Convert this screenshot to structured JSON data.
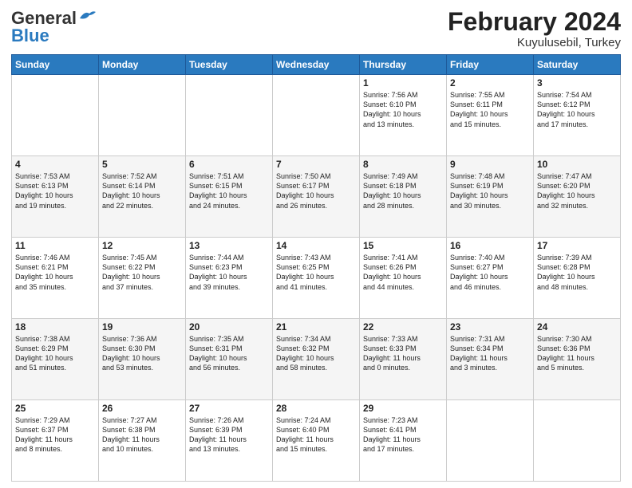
{
  "header": {
    "logo_line1": "General",
    "logo_line2": "Blue",
    "title": "February 2024",
    "subtitle": "Kuyulusebil, Turkey"
  },
  "days_of_week": [
    "Sunday",
    "Monday",
    "Tuesday",
    "Wednesday",
    "Thursday",
    "Friday",
    "Saturday"
  ],
  "weeks": [
    [
      {
        "day": "",
        "info": ""
      },
      {
        "day": "",
        "info": ""
      },
      {
        "day": "",
        "info": ""
      },
      {
        "day": "",
        "info": ""
      },
      {
        "day": "1",
        "info": "Sunrise: 7:56 AM\nSunset: 6:10 PM\nDaylight: 10 hours\nand 13 minutes."
      },
      {
        "day": "2",
        "info": "Sunrise: 7:55 AM\nSunset: 6:11 PM\nDaylight: 10 hours\nand 15 minutes."
      },
      {
        "day": "3",
        "info": "Sunrise: 7:54 AM\nSunset: 6:12 PM\nDaylight: 10 hours\nand 17 minutes."
      }
    ],
    [
      {
        "day": "4",
        "info": "Sunrise: 7:53 AM\nSunset: 6:13 PM\nDaylight: 10 hours\nand 19 minutes."
      },
      {
        "day": "5",
        "info": "Sunrise: 7:52 AM\nSunset: 6:14 PM\nDaylight: 10 hours\nand 22 minutes."
      },
      {
        "day": "6",
        "info": "Sunrise: 7:51 AM\nSunset: 6:15 PM\nDaylight: 10 hours\nand 24 minutes."
      },
      {
        "day": "7",
        "info": "Sunrise: 7:50 AM\nSunset: 6:17 PM\nDaylight: 10 hours\nand 26 minutes."
      },
      {
        "day": "8",
        "info": "Sunrise: 7:49 AM\nSunset: 6:18 PM\nDaylight: 10 hours\nand 28 minutes."
      },
      {
        "day": "9",
        "info": "Sunrise: 7:48 AM\nSunset: 6:19 PM\nDaylight: 10 hours\nand 30 minutes."
      },
      {
        "day": "10",
        "info": "Sunrise: 7:47 AM\nSunset: 6:20 PM\nDaylight: 10 hours\nand 32 minutes."
      }
    ],
    [
      {
        "day": "11",
        "info": "Sunrise: 7:46 AM\nSunset: 6:21 PM\nDaylight: 10 hours\nand 35 minutes."
      },
      {
        "day": "12",
        "info": "Sunrise: 7:45 AM\nSunset: 6:22 PM\nDaylight: 10 hours\nand 37 minutes."
      },
      {
        "day": "13",
        "info": "Sunrise: 7:44 AM\nSunset: 6:23 PM\nDaylight: 10 hours\nand 39 minutes."
      },
      {
        "day": "14",
        "info": "Sunrise: 7:43 AM\nSunset: 6:25 PM\nDaylight: 10 hours\nand 41 minutes."
      },
      {
        "day": "15",
        "info": "Sunrise: 7:41 AM\nSunset: 6:26 PM\nDaylight: 10 hours\nand 44 minutes."
      },
      {
        "day": "16",
        "info": "Sunrise: 7:40 AM\nSunset: 6:27 PM\nDaylight: 10 hours\nand 46 minutes."
      },
      {
        "day": "17",
        "info": "Sunrise: 7:39 AM\nSunset: 6:28 PM\nDaylight: 10 hours\nand 48 minutes."
      }
    ],
    [
      {
        "day": "18",
        "info": "Sunrise: 7:38 AM\nSunset: 6:29 PM\nDaylight: 10 hours\nand 51 minutes."
      },
      {
        "day": "19",
        "info": "Sunrise: 7:36 AM\nSunset: 6:30 PM\nDaylight: 10 hours\nand 53 minutes."
      },
      {
        "day": "20",
        "info": "Sunrise: 7:35 AM\nSunset: 6:31 PM\nDaylight: 10 hours\nand 56 minutes."
      },
      {
        "day": "21",
        "info": "Sunrise: 7:34 AM\nSunset: 6:32 PM\nDaylight: 10 hours\nand 58 minutes."
      },
      {
        "day": "22",
        "info": "Sunrise: 7:33 AM\nSunset: 6:33 PM\nDaylight: 11 hours\nand 0 minutes."
      },
      {
        "day": "23",
        "info": "Sunrise: 7:31 AM\nSunset: 6:34 PM\nDaylight: 11 hours\nand 3 minutes."
      },
      {
        "day": "24",
        "info": "Sunrise: 7:30 AM\nSunset: 6:36 PM\nDaylight: 11 hours\nand 5 minutes."
      }
    ],
    [
      {
        "day": "25",
        "info": "Sunrise: 7:29 AM\nSunset: 6:37 PM\nDaylight: 11 hours\nand 8 minutes."
      },
      {
        "day": "26",
        "info": "Sunrise: 7:27 AM\nSunset: 6:38 PM\nDaylight: 11 hours\nand 10 minutes."
      },
      {
        "day": "27",
        "info": "Sunrise: 7:26 AM\nSunset: 6:39 PM\nDaylight: 11 hours\nand 13 minutes."
      },
      {
        "day": "28",
        "info": "Sunrise: 7:24 AM\nSunset: 6:40 PM\nDaylight: 11 hours\nand 15 minutes."
      },
      {
        "day": "29",
        "info": "Sunrise: 7:23 AM\nSunset: 6:41 PM\nDaylight: 11 hours\nand 17 minutes."
      },
      {
        "day": "",
        "info": ""
      },
      {
        "day": "",
        "info": ""
      }
    ]
  ]
}
